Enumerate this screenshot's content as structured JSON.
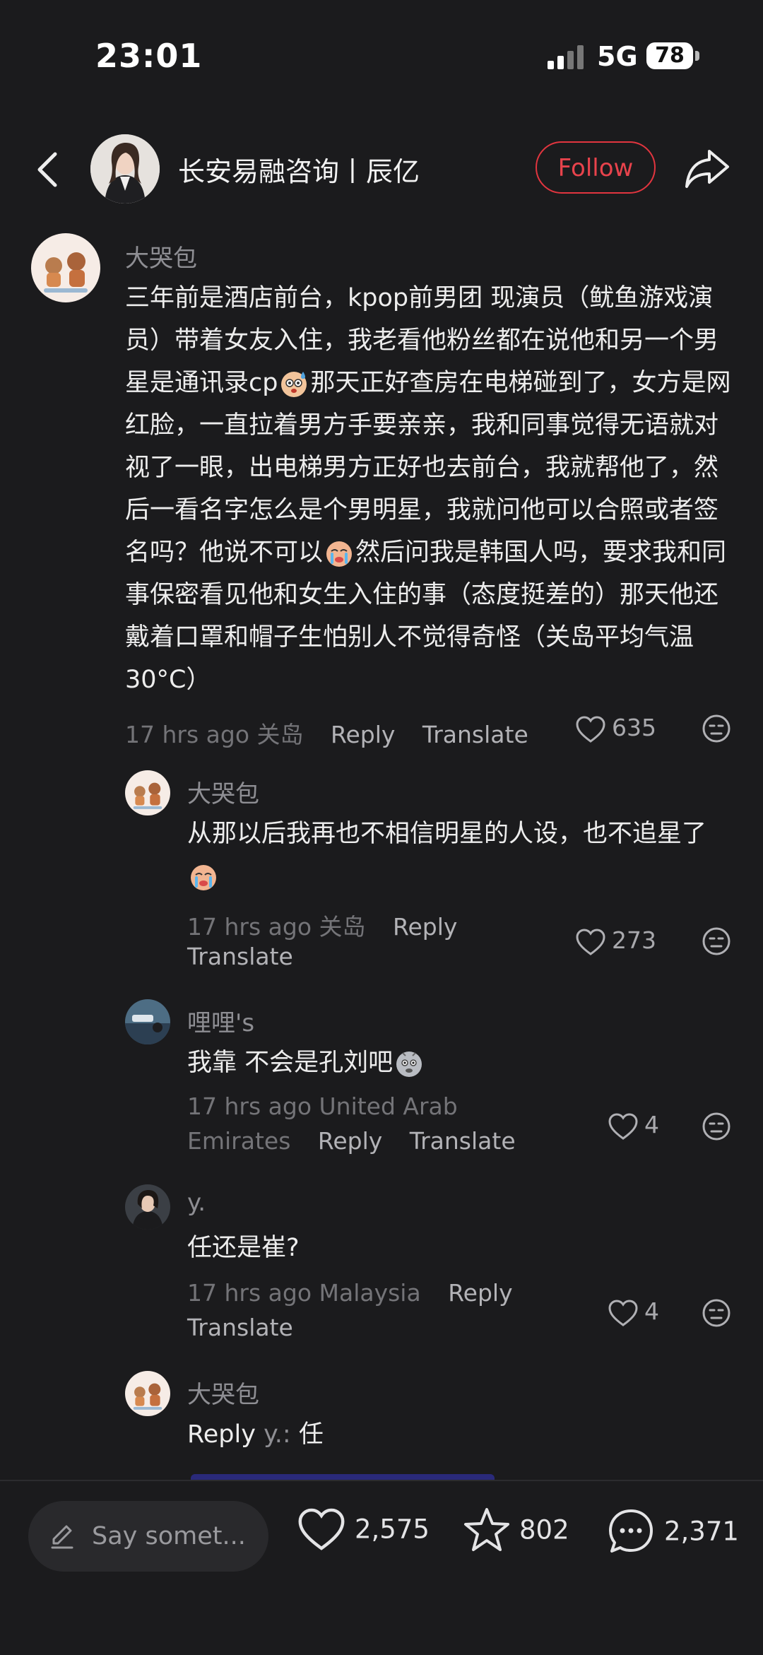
{
  "status_bar": {
    "time": "23:01",
    "network": "5G",
    "battery": "78"
  },
  "header": {
    "account_name": "长安易融咨询丨辰亿",
    "follow_label": "Follow"
  },
  "comments": [
    {
      "author": "大哭包",
      "text_parts": [
        "三年前是酒店前台，kpop前男团 现演员（鱿鱼游戏演员）带着女友入住，我老看他粉丝都在说他和另一个男星是通讯录cp",
        "那天正好查房在电梯碰到了，女方是网红脸，一直拉着男方手要亲亲，我和同事觉得无语就对视了一眼，出电梯男方正好也去前台，我就帮他了，然后一看名字怎么是个男明星，我就问他可以合照或者签名吗？他说不可以",
        "然后问我是韩国人吗，要求我和同事保密看见他和女生入住的事（态度挺差的）那天他还戴着口罩和帽子生怕别人不觉得奇怪（关岛平均气温30°C）"
      ],
      "time_location": "17 hrs ago 关岛",
      "reply_label": "Reply",
      "translate_label": "Translate",
      "likes": "635"
    },
    {
      "author": "大哭包",
      "text": "从那以后我再也不相信明星的人设，也不追星了",
      "time_location": "17 hrs ago 关岛",
      "reply_label": "Reply",
      "translate_label": "Translate",
      "likes": "273"
    },
    {
      "author": "哩哩's",
      "text": "我靠 不会是孔刘吧",
      "time_location_1": "17 hrs ago United Arab",
      "time_location_2": "Emirates",
      "reply_label": "Reply",
      "translate_label": "Translate",
      "likes": "4"
    },
    {
      "author": "y.",
      "text": "任还是崔?",
      "time_location": "17 hrs ago Malaysia",
      "reply_label": "Reply",
      "translate_label": "Translate",
      "likes": "4"
    },
    {
      "author": "大哭包",
      "reply_prefix": "Reply",
      "reply_target": "y.:",
      "text": "任"
    }
  ],
  "bottom_bar": {
    "input_placeholder": "Say somet...",
    "likes": "2,575",
    "favorites": "802",
    "comments": "2,371"
  },
  "icons": [
    "back-icon",
    "share-icon",
    "heart-icon",
    "dislike-icon",
    "star-icon",
    "comment-icon",
    "pencil-icon",
    "signal-icon"
  ],
  "colors": {
    "background": "#1b1b1d",
    "follow": "#e2353f",
    "secondary_text": "#8e8e93"
  }
}
